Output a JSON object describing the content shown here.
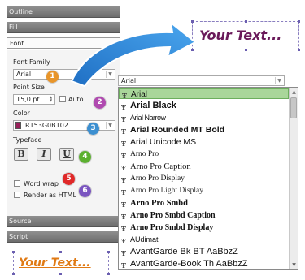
{
  "panel": {
    "sections": {
      "outline": "Outline",
      "fill": "Fill",
      "font": "Font",
      "source": "Source",
      "script": "Script"
    },
    "font_family": {
      "label": "Font Family",
      "value": "Arial"
    },
    "point_size": {
      "label": "Point Size",
      "value": "15,0 pt",
      "auto_label": "Auto"
    },
    "color": {
      "label": "Color",
      "value": "R153G0B102",
      "swatch": "#99205a"
    },
    "typeface": {
      "label": "Typeface",
      "bold": "B",
      "italic": "I",
      "underline": "U"
    },
    "word_wrap": {
      "label": "Word wrap"
    },
    "render_html": {
      "label": "Render as HTML"
    }
  },
  "badges": {
    "b1": {
      "text": "1",
      "color": "#e8952a"
    },
    "b2": {
      "text": "2",
      "color": "#b04ab0"
    },
    "b3": {
      "text": "3",
      "color": "#3c8fd0"
    },
    "b4": {
      "text": "4",
      "color": "#5cb030"
    },
    "b5": {
      "text": "5",
      "color": "#e02828"
    },
    "b6": {
      "text": "6",
      "color": "#7a55c0"
    }
  },
  "samples": {
    "top": "Your Text...",
    "bottom": "Your Text..."
  },
  "font_list": {
    "selected": "Arial",
    "items": [
      "Arial",
      "Arial Black",
      "Arial Narrow",
      "Arial Rounded MT Bold",
      "Arial Unicode MS",
      "Arno Pro",
      "Arno Pro Caption",
      "Arno Pro Display",
      "Arno Pro Light Display",
      "Arno Pro Smbd",
      "Arno Pro Smbd Caption",
      "Arno Pro Smbd Display",
      "AUdimat",
      "AvantGarde Bk BT AaBbzZ",
      "AvantGarde-Book Th AaBbzZ"
    ]
  },
  "colors": {
    "accent_selection": "#a9d69a",
    "arrow_blue": "#2f86d6",
    "sample_top": "#6a1a5a",
    "sample_bottom": "#e07a14"
  },
  "icons": [
    "truetype-icon",
    "chevron-down-icon",
    "big-curved-arrow-icon"
  ]
}
